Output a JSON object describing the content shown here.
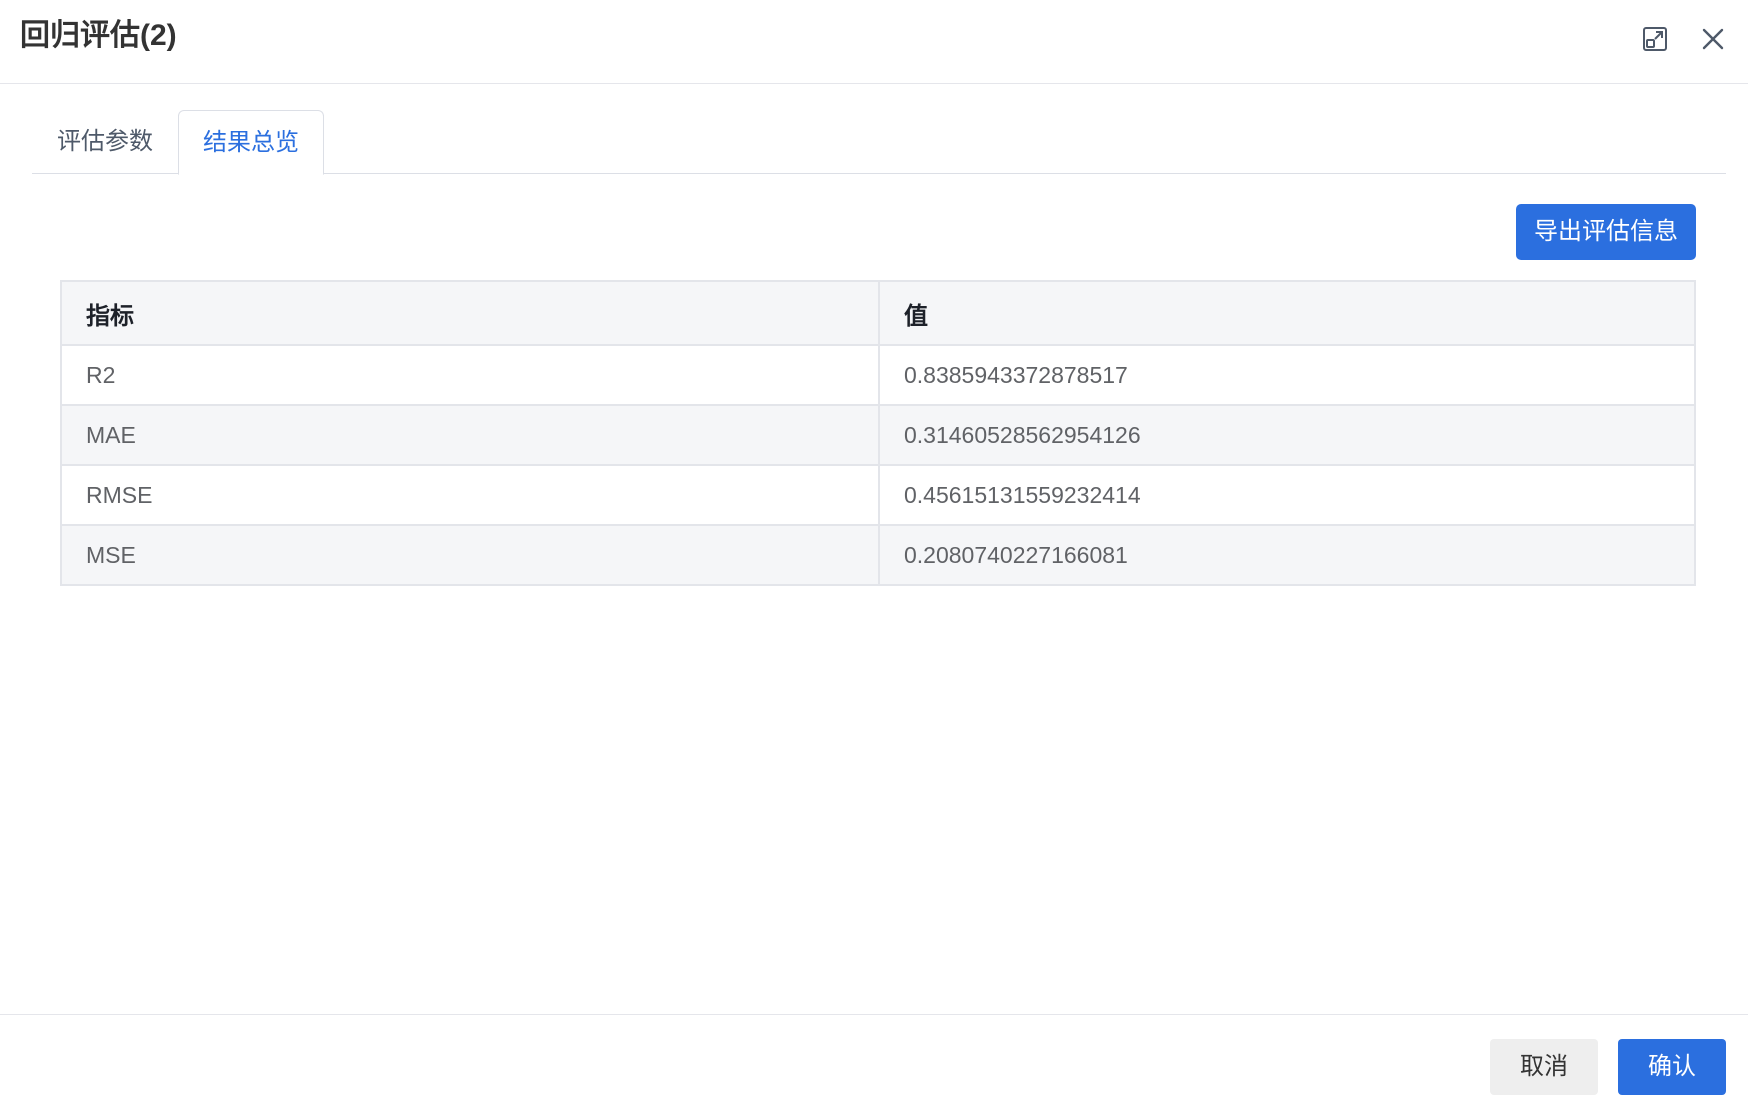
{
  "dialog": {
    "title": "回归评估(2)",
    "icons": {
      "maximize": "maximize-icon",
      "close": "close-icon"
    }
  },
  "tabs": [
    {
      "label": "评估参数",
      "active": false
    },
    {
      "label": "结果总览",
      "active": true
    }
  ],
  "toolbar": {
    "export_label": "导出评估信息"
  },
  "table": {
    "headers": [
      "指标",
      "值"
    ],
    "rows": [
      {
        "metric": "R2",
        "value": "0.8385943372878517"
      },
      {
        "metric": "MAE",
        "value": "0.31460528562954126"
      },
      {
        "metric": "RMSE",
        "value": "0.45615131559232414"
      },
      {
        "metric": "MSE",
        "value": "0.2080740227166081"
      }
    ]
  },
  "footer": {
    "cancel_label": "取消",
    "confirm_label": "确认"
  },
  "colors": {
    "primary": "#2b6fdf",
    "header_bg": "#f5f6f8",
    "border": "#e3e5ea"
  }
}
